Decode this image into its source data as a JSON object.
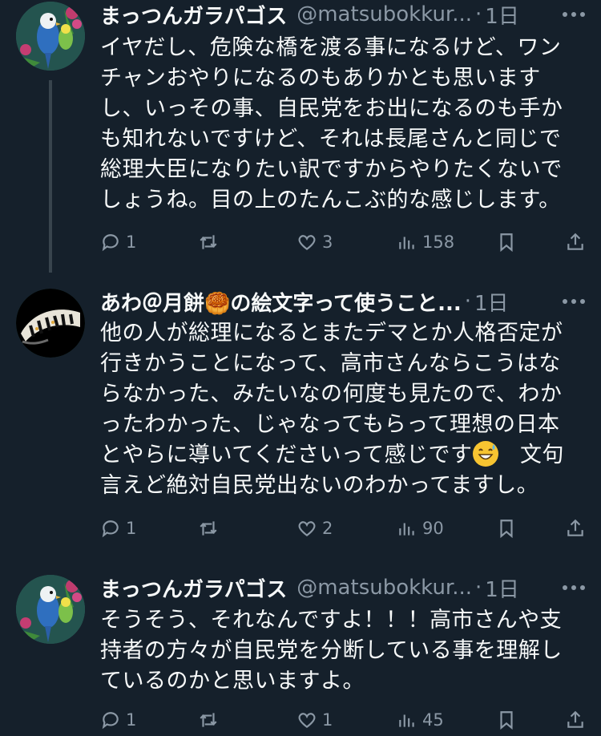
{
  "tweets": [
    {
      "name": "まっつんガラパゴス",
      "handle": "@matsubokkur...",
      "time": "1日",
      "text": "イヤだし、危険な橋を渡る事になるけど、ワンチャンおやりになるのもありかとも思いますし、いっその事、自民党をお出になるのも手かも知れないですけど、それは長尾さんと同じで総理大臣になりたい訳ですからやりたくないでしょうね。目の上のたんこぶ的な感じします。",
      "replies": "1",
      "retweets": "",
      "likes": "3",
      "views": "158"
    },
    {
      "name": "あわ＠月餅🥮の絵文字って使うこと...",
      "handle": "",
      "time": "1日",
      "text_main": "他の人が総理になるとまたデマとか人格否定が行きかうことになって、高市さんならこうはならなかった、みたいなの何度も見たので、わかったわかった、じゃなってもらって理想の日本とやらに導いてくださいって感じです",
      "text_tail": "　文句言えど絶対自民党出ないのわかってますし。",
      "replies": "1",
      "retweets": "",
      "likes": "2",
      "views": "90"
    },
    {
      "name": "まっつんガラパゴス",
      "handle": "@matsubokkur...",
      "time": "1日",
      "text": "そうそう、それなんですよ！！！高市さんや支持者の方々が自民党を分断している事を理解しているのかと思いますよ。",
      "replies": "1",
      "retweets": "",
      "likes": "1",
      "views": "45"
    }
  ],
  "icons": [
    "reply-icon",
    "retweet-icon",
    "like-icon",
    "views-icon",
    "bookmark-icon",
    "share-icon",
    "more-icon",
    "grinning-sweat-emoji"
  ],
  "colors": {
    "background": "#15202b",
    "text": "#f7f9f9",
    "secondary": "#8b98a5",
    "thread_line": "#38444d"
  }
}
